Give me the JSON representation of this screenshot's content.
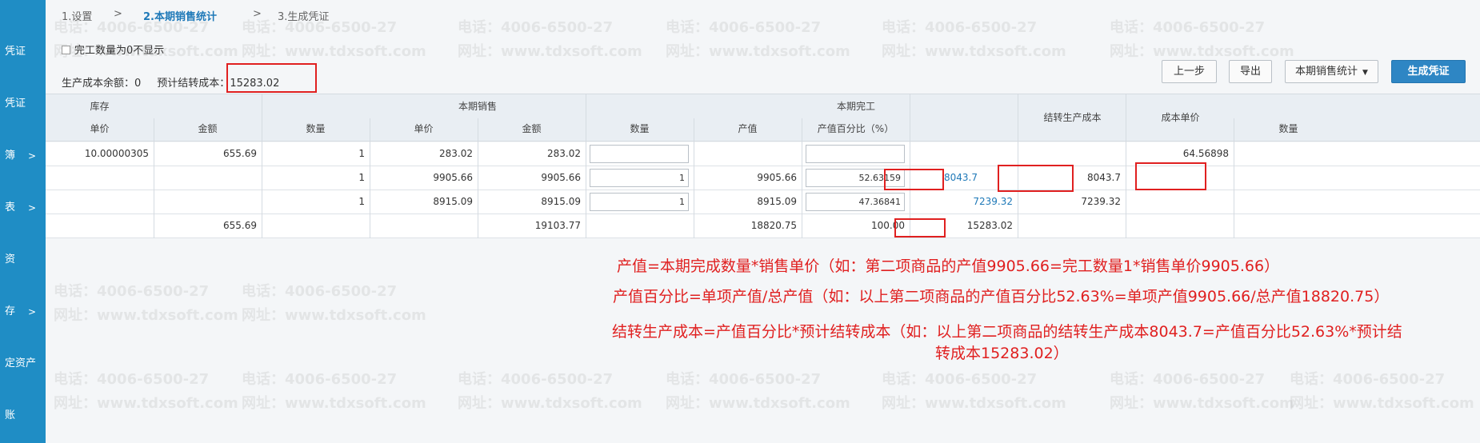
{
  "sidebar": {
    "items": [
      {
        "label": "凭证",
        "chevron": ""
      },
      {
        "label": "凭证",
        "chevron": ""
      },
      {
        "label": "簿",
        "chevron": ">"
      },
      {
        "label": "表",
        "chevron": ">"
      },
      {
        "label": "资",
        "chevron": ""
      },
      {
        "label": "存",
        "chevron": ">"
      },
      {
        "label": "定资产",
        "chevron": ""
      },
      {
        "label": "账",
        "chevron": ""
      }
    ]
  },
  "steps": {
    "step1": "1.设置",
    "sep1": ">",
    "step2": "2.本期销售统计",
    "sep2": ">",
    "step3": "3.生成凭证"
  },
  "filter": {
    "label": "完工数量为0不显示",
    "checked": false
  },
  "summary": {
    "prod_balance_label": "生产成本余额：",
    "prod_balance_value": "0",
    "est_cost_label": "预计结转成本：",
    "est_cost_value": "15283.02"
  },
  "toolbar": {
    "prev_label": "上一步",
    "export_label": "导出",
    "select_label": "本期销售统计",
    "generate_label": "生成凭证"
  },
  "table": {
    "groups": {
      "inventory": "库存",
      "sales": "本期销售",
      "completed": "本期完工",
      "transfer": "结转生产成本",
      "unit_cost": "成本单价"
    },
    "cols": {
      "inv_price": "单价",
      "inv_amount": "金额",
      "sales_qty": "数量",
      "sales_price": "单价",
      "sales_amount": "金额",
      "comp_qty": "数量",
      "comp_value": "产值",
      "comp_pct": "产值百分比（%）",
      "last_qty": "数量"
    },
    "rows": [
      {
        "inv_price": "10.00000305",
        "inv_amount": "655.69",
        "sales_qty": "1",
        "sales_price": "283.02",
        "sales_amount": "283.02",
        "comp_qty": "",
        "comp_value": "",
        "comp_pct": "",
        "transfer": "",
        "unit_cost": "",
        "last_qty": "64.56898"
      },
      {
        "inv_price": "",
        "inv_amount": "",
        "sales_qty": "1",
        "sales_price": "9905.66",
        "sales_amount": "9905.66",
        "comp_qty": "1",
        "comp_value": "9905.66",
        "comp_pct": "52.63159",
        "transfer": "8043.7",
        "unit_cost": "8043.7",
        "last_qty": ""
      },
      {
        "inv_price": "",
        "inv_amount": "",
        "sales_qty": "1",
        "sales_price": "8915.09",
        "sales_amount": "8915.09",
        "comp_qty": "1",
        "comp_value": "8915.09",
        "comp_pct": "47.36841",
        "transfer": "7239.32",
        "unit_cost": "7239.32",
        "last_qty": ""
      },
      {
        "inv_price": "",
        "inv_amount": "655.69",
        "sales_qty": "",
        "sales_price": "",
        "sales_amount": "19103.77",
        "comp_qty": "",
        "comp_value": "18820.75",
        "comp_pct": "100.00",
        "transfer": "15283.02",
        "unit_cost": "",
        "last_qty": ""
      }
    ]
  },
  "annotations": {
    "line1": "产值=本期完成数量*销售单价（如：第二项商品的产值9905.66=完工数量1*销售单价9905.66）",
    "line2": "产值百分比=单项产值/总产值（如：以上第二项商品的产值百分比52.63%=单项产值9905.66/总产值18820.75）",
    "line3a": "结转生产成本=产值百分比*预计结转成本（如：以上第二项商品的结转生产成本8043.7=产值百分比52.63%*预计结",
    "line3b": "转成本15283.02）"
  },
  "watermark": {
    "phone": "电话：4006-6500-27",
    "site": "网址：www.tdxsoft.com"
  },
  "colors": {
    "sidebar": "#1f8dc5",
    "primary_button": "#2e86c4",
    "annotation_red": "#e02020",
    "link_blue": "#1f79b8"
  }
}
